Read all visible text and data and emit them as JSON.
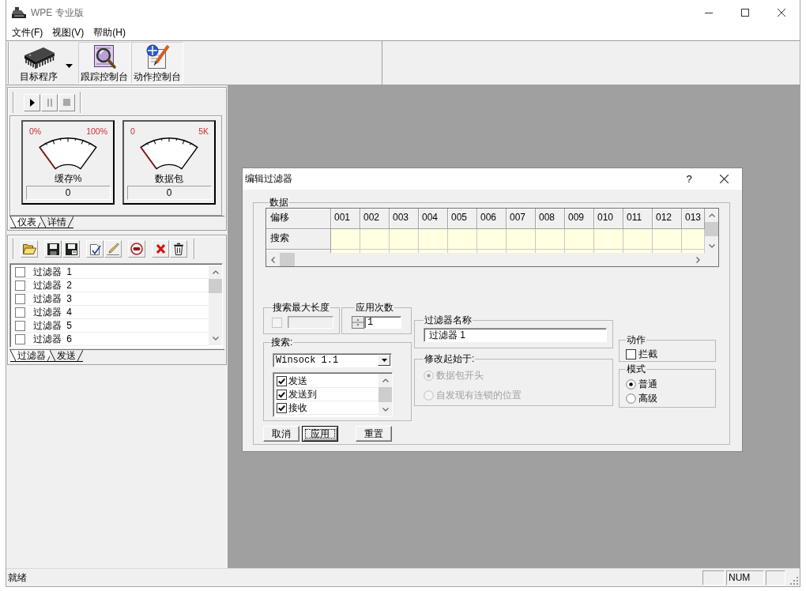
{
  "window": {
    "title": "WPE 专业版"
  },
  "menu": [
    {
      "label": "文件(F)"
    },
    {
      "label": "视图(V)"
    },
    {
      "label": "帮助(H)"
    }
  ],
  "toolbar": {
    "buttons": [
      {
        "label": "目标程序",
        "dropdown": true,
        "checked": false
      },
      {
        "label": "跟踪控制台",
        "dropdown": false,
        "checked": true
      },
      {
        "label": "动作控制台",
        "dropdown": false,
        "checked": true
      }
    ]
  },
  "meter_panel": {
    "controls": {
      "play": {
        "disabled": false
      },
      "pause": {
        "disabled": true
      },
      "stop": {
        "disabled": true
      }
    },
    "meters": [
      {
        "min_label": "0%",
        "max_label": "100%",
        "caption": "缓存%",
        "reading": "0"
      },
      {
        "min_label": "0",
        "max_label": "5K",
        "caption": "数据包",
        "reading": "0"
      }
    ],
    "tabs": [
      {
        "label": "仪表",
        "selected": true
      },
      {
        "label": "详情",
        "selected": false
      }
    ]
  },
  "filter_panel": {
    "filters": [
      {
        "label": "过滤器 1",
        "checked": false
      },
      {
        "label": "过滤器 2",
        "checked": false
      },
      {
        "label": "过滤器 3",
        "checked": false
      },
      {
        "label": "过滤器 4",
        "checked": false
      },
      {
        "label": "过滤器 5",
        "checked": false
      },
      {
        "label": "过滤器 6",
        "checked": false
      }
    ],
    "tabs": [
      {
        "label": "过滤器",
        "selected": true
      },
      {
        "label": "发送",
        "selected": false
      }
    ]
  },
  "dialog": {
    "title": "编辑过滤器",
    "help": "?",
    "data": {
      "title": "数据",
      "row_header": "偏移",
      "columns": [
        "001",
        "002",
        "003",
        "004",
        "005",
        "006",
        "007",
        "008",
        "009",
        "010",
        "011",
        "012",
        "013"
      ],
      "rows": [
        {
          "label": "搜索"
        },
        {
          "cut_off": true
        }
      ]
    },
    "max_length": {
      "title": "搜索最大长度",
      "checked": false,
      "disabled": true
    },
    "apply_count": {
      "title": "应用次数",
      "value": "1"
    },
    "search": {
      "title": "搜索:",
      "api": "Winsock 1.1",
      "functions": [
        {
          "label": "发送",
          "checked": true
        },
        {
          "label": "发送到",
          "checked": true
        },
        {
          "label": "接收",
          "checked": true
        }
      ]
    },
    "buttons": [
      {
        "label": "取消",
        "focused": false
      },
      {
        "label": "应用",
        "focused": true
      },
      {
        "label": "重置",
        "focused": false
      }
    ],
    "filter_name": {
      "title": "过滤器名称",
      "value": "过滤器 1"
    },
    "modify_from": {
      "title": "修改起始于:",
      "disabled": true,
      "options": [
        {
          "label": "数据包开头",
          "selected": true
        },
        {
          "label": "自发现有连锁的位置",
          "selected": false
        }
      ]
    },
    "action": {
      "title": "动作",
      "options": [
        {
          "label": "拦截",
          "checked": false
        }
      ]
    },
    "mode": {
      "title": "模式",
      "options": [
        {
          "label": "普通",
          "selected": true
        },
        {
          "label": "高级",
          "selected": false
        }
      ]
    }
  },
  "status_bar": {
    "text": "就绪",
    "indicator": "NUM"
  }
}
